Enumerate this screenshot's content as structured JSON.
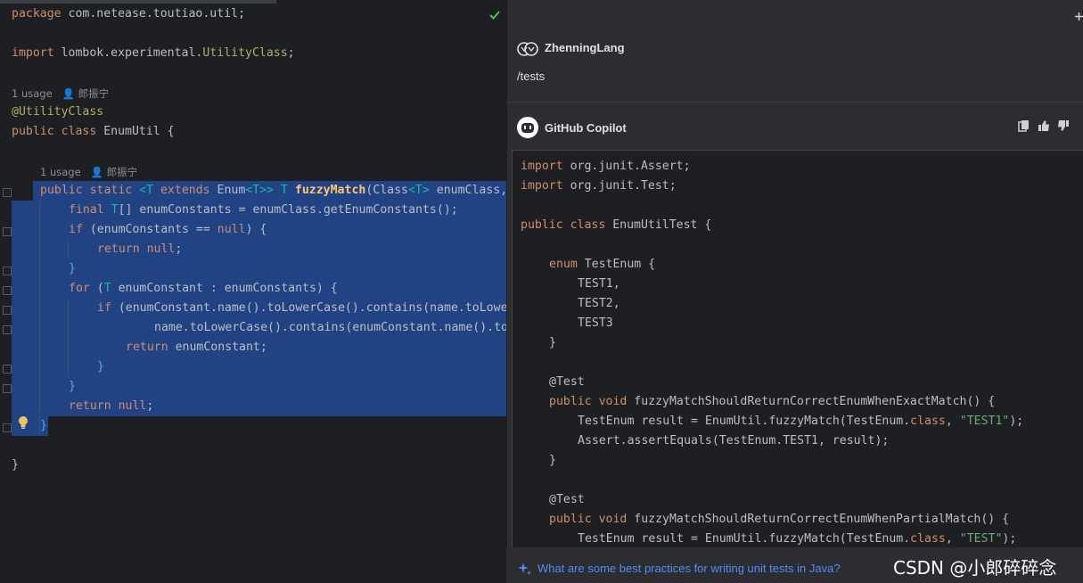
{
  "editor": {
    "package_kw": "package",
    "package_name": " com.netease.toutiao.util;",
    "import_kw": "import",
    "import_pkg": " lombok.experimental.",
    "import_cls": "UtilityClass",
    "import_end": ";",
    "hint1_usage": "1 usage",
    "hint1_author": "郎振宁",
    "annotation": "@UtilityClass",
    "class_public": "public",
    "class_kw": " class",
    "class_name": " EnumUtil {",
    "hint2_usage": "1 usage",
    "hint2_author": "郎振宁",
    "lines": {
      "m_public": "public static ",
      "m_lt": "<",
      "m_T": "T",
      "m_extends": " extends ",
      "m_enum": "Enum",
      "m_lt2": "<",
      "m_T2": "T",
      "m_gt": ">>",
      "m_T3": " T ",
      "m_name": "fuzzyMatch",
      "m_rest": "(Class",
      "m_lt3": "<",
      "m_T4": "T",
      "m_gt2": ">",
      "m_args": " enumClass,",
      "l1_kw": "final ",
      "l1_T": "T",
      "l1_rest": "[] enumConstants = enumClass.getEnumConstants();",
      "l2_kw": "if",
      "l2_rest": " (enumConstants == ",
      "l2_null": "null",
      "l2_end": ") {",
      "l3_kw": "return ",
      "l3_null": "null",
      "l3_end": ";",
      "l4": "}",
      "l5_kw": "for",
      "l5_a": " (",
      "l5_T": "T",
      "l5_rest": " enumConstant : enumConstants) {",
      "l6_kw": "if",
      "l6_rest": " (enumConstant.name().toLowerCase().contains(name.toLowe",
      "l7": "name.toLowerCase().contains(enumConstant.name().to",
      "l8_kw": "return",
      "l8_rest": " enumConstant;",
      "l9": "}",
      "l10": "}",
      "l11_kw": "return ",
      "l11_null": "null",
      "l11_end": ";",
      "l12": "}",
      "l13": "}"
    }
  },
  "chat": {
    "user_name": "ZhenningLang",
    "command": "/tests",
    "assistant_name": "GitHub Copilot",
    "code": {
      "c1_kw": "import",
      "c1_rest": " org.junit.Assert;",
      "c2_kw": "import",
      "c2_rest": " org.junit.Test;",
      "c3_kw": "public class",
      "c3_rest": " EnumUtilTest {",
      "c4_kw": "enum",
      "c4_rest": " TestEnum {",
      "c5": "TEST1,",
      "c6": "TEST2,",
      "c7": "TEST3",
      "c8": "}",
      "c9": "@Test",
      "c10_kw": "public void",
      "c10_rest": " fuzzyMatchShouldReturnCorrectEnumWhenExactMatch() {",
      "c11_a": "TestEnum result = EnumUtil.fuzzyMatch(TestEnum.",
      "c11_kw": "class",
      "c11_b": ", ",
      "c11_str": "\"TEST1\"",
      "c11_c": ");",
      "c12": "Assert.assertEquals(TestEnum.TEST1, result);",
      "c13": "}",
      "c14": "@Test",
      "c15_kw": "public void",
      "c15_rest": " fuzzyMatchShouldReturnCorrectEnumWhenPartialMatch() {",
      "c16_a": "TestEnum result = EnumUtil.fuzzyMatch(TestEnum.",
      "c16_kw": "class",
      "c16_b": ", ",
      "c16_str": "\"TEST\"",
      "c16_c": ");"
    },
    "suggestion": "What are some best practices for writing unit tests in Java?"
  },
  "watermark": "CSDN @小郎碎碎念",
  "colors": {
    "keyword": "#cf8e6d",
    "annotation": "#b3ae60",
    "type_param": "#16baac",
    "function": "#56a8f5",
    "string": "#6aab73",
    "selection": "#214283",
    "link": "#548af7"
  }
}
